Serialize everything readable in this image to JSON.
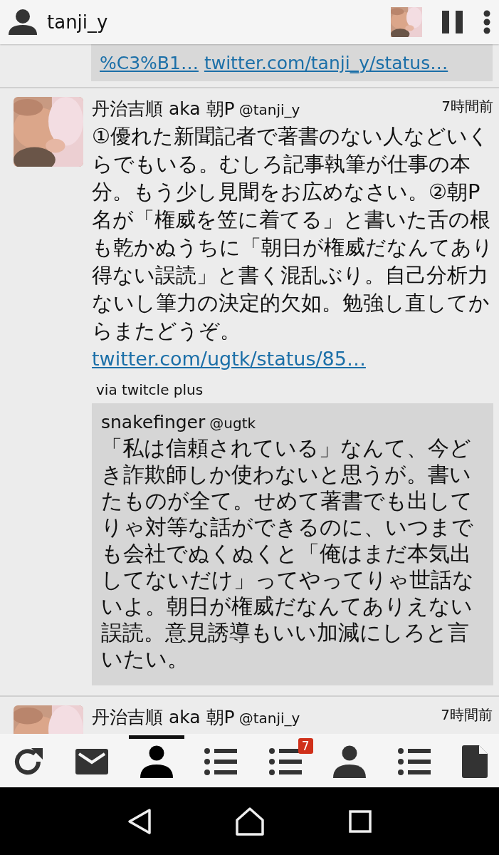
{
  "header": {
    "account": "tanji_y"
  },
  "previous_quote": {
    "links": [
      "%C3%B1…",
      "twitter.com/tanji_y/status…"
    ]
  },
  "tweets": [
    {
      "name": "丹治吉順 aka 朝P",
      "handle": "@tanji_y",
      "time": "7時間前",
      "text": "①優れた新聞記者で著書のない人などいくらでもいる。むしろ記事執筆が仕事の本分。もう少し見聞をお広めなさい。②朝P名が「権威を笠に着てる」と書いた舌の根も乾かぬうちに「朝日が権威だなんてあり得ない誤読」と書く混乱ぶり。自己分析力ないし筆力の決定的欠如。勉強し直してからまたどうぞ。",
      "link": "twitter.com/ugtk/status/85…",
      "via": "via twitcle plus",
      "quote": {
        "name": "snakefinger",
        "handle": "@ugtk",
        "text": "「私は信頼されている」なんて、今どき詐欺師しか使わないと思うが。書いたものが全て。せめて著書でも出してりゃ対等な話ができるのに、いつまでも会社でぬくぬくと「俺はまだ本気出してないだけ」ってやってりゃ世話ないよ。朝日が権威だなんてありえない誤読。意見誘導もいい加減にしろと言いたい。"
      }
    },
    {
      "name": "丹治吉順 aka 朝P",
      "handle": "@tanji_y",
      "time": "7時間前"
    }
  ],
  "tab_bar": [
    {
      "kind": "refresh",
      "selected": false
    },
    {
      "kind": "mail",
      "selected": false
    },
    {
      "kind": "person",
      "selected": true
    },
    {
      "kind": "list",
      "selected": false
    },
    {
      "kind": "list",
      "selected": false,
      "badge": "7"
    },
    {
      "kind": "person",
      "selected": false
    },
    {
      "kind": "list",
      "selected": false
    },
    {
      "kind": "document",
      "selected": false
    }
  ]
}
